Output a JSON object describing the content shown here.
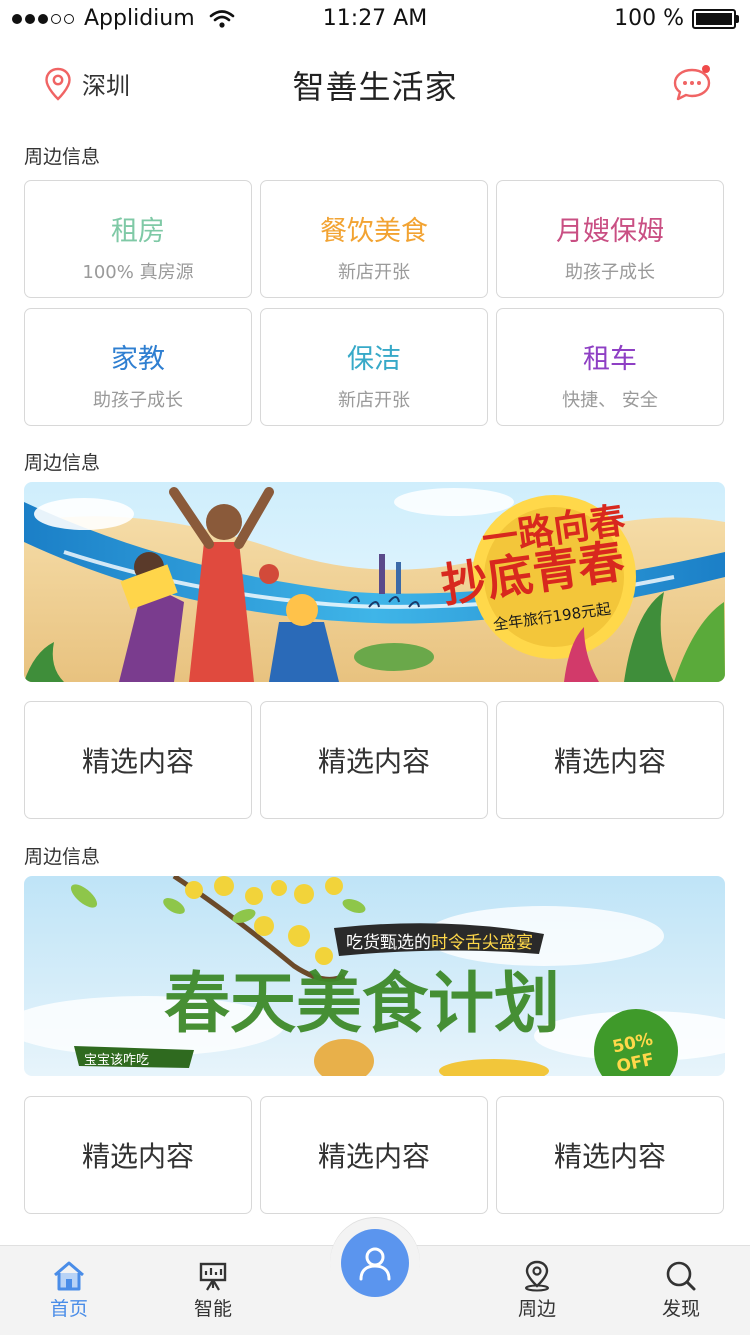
{
  "status_bar": {
    "carrier": "Applidium",
    "time": "11:27 AM",
    "battery": "100 %"
  },
  "header": {
    "location": "深圳",
    "title": "智善生活家"
  },
  "sections": [
    {
      "label": "周边信息"
    },
    {
      "label": "周边信息"
    },
    {
      "label": "周边信息"
    }
  ],
  "services": [
    {
      "title": "租房",
      "subtitle": "100% 真房源",
      "color": "#7fc9a6"
    },
    {
      "title": "餐饮美食",
      "subtitle": "新店开张",
      "color": "#f2a332"
    },
    {
      "title": "月嫂保姆",
      "subtitle": "助孩子成长",
      "color": "#c94f83"
    },
    {
      "title": "家教",
      "subtitle": "助孩子成长",
      "color": "#2f7fd1"
    },
    {
      "title": "保洁",
      "subtitle": "新店开张",
      "color": "#37a9c8"
    },
    {
      "title": "租车",
      "subtitle": "快捷、  安全",
      "color": "#8e3fc4"
    }
  ],
  "banner1": {
    "headline": "一路向春",
    "headline2": "抄底青春",
    "tagline": "全年旅行198元起"
  },
  "banner2": {
    "tagline": "吃货甄选的时令舌尖盛宴",
    "headline": "春天美食计划",
    "badge": "50% OFF",
    "ribbon": "宝宝该咋吃"
  },
  "featured_row1": [
    "精选内容",
    "精选内容",
    "精选内容"
  ],
  "featured_row2": [
    "精选内容",
    "精选内容",
    "精选内容"
  ],
  "tabs": [
    {
      "label": "首页",
      "icon": "home-icon",
      "active": true
    },
    {
      "label": "智能",
      "icon": "easel-icon",
      "active": false
    },
    {
      "label": "周边",
      "icon": "location-pin-icon",
      "active": false
    },
    {
      "label": "发现",
      "icon": "search-icon",
      "active": false
    }
  ],
  "colors": {
    "accent": "#4a8de8",
    "center_button": "#5b95ee",
    "notification_dot": "#f04a4a"
  }
}
